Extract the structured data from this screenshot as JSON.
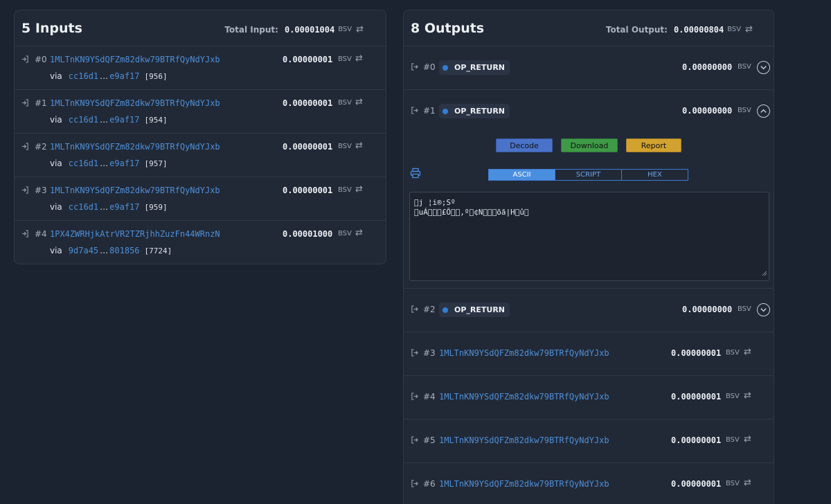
{
  "inputs": {
    "title": "5 Inputs",
    "total_label": "Total Input:",
    "total_value": "0.00001004",
    "unit": "BSV",
    "rows": [
      {
        "index": "#0",
        "address": "1MLTnKN9YSdQFZm82dkw79BTRfQyNdYJxb",
        "amount": "0.00000001",
        "unit": "BSV",
        "via_label": "via",
        "via_start": "cc16d1",
        "via_dots": "…",
        "via_end": "e9af17",
        "via_index": "[956]"
      },
      {
        "index": "#1",
        "address": "1MLTnKN9YSdQFZm82dkw79BTRfQyNdYJxb",
        "amount": "0.00000001",
        "unit": "BSV",
        "via_label": "via",
        "via_start": "cc16d1",
        "via_dots": "…",
        "via_end": "e9af17",
        "via_index": "[954]"
      },
      {
        "index": "#2",
        "address": "1MLTnKN9YSdQFZm82dkw79BTRfQyNdYJxb",
        "amount": "0.00000001",
        "unit": "BSV",
        "via_label": "via",
        "via_start": "cc16d1",
        "via_dots": "…",
        "via_end": "e9af17",
        "via_index": "[957]"
      },
      {
        "index": "#3",
        "address": "1MLTnKN9YSdQFZm82dkw79BTRfQyNdYJxb",
        "amount": "0.00000001",
        "unit": "BSV",
        "via_label": "via",
        "via_start": "cc16d1",
        "via_dots": "…",
        "via_end": "e9af17",
        "via_index": "[959]"
      },
      {
        "index": "#4",
        "address": "1PX4ZWRHjkAtrVR2TZRjhhZuzFn44WRnzN",
        "amount": "0.00001000",
        "unit": "BSV",
        "via_label": "via",
        "via_start": "9d7a45",
        "via_dots": "…",
        "via_end": "801856",
        "via_index": "[7724]"
      }
    ]
  },
  "outputs": {
    "title": "8 Outputs",
    "total_label": "Total Output:",
    "total_value": "0.00000804",
    "unit": "BSV",
    "rows": [
      {
        "index": "#0",
        "badge": "OP_RETURN",
        "amount": "0.00000000",
        "unit": "BSV"
      },
      {
        "index": "#1",
        "badge": "OP_RETURN",
        "amount": "0.00000000",
        "unit": "BSV"
      },
      {
        "index": "#2",
        "badge": "OP_RETURN",
        "amount": "0.00000000",
        "unit": "BSV"
      },
      {
        "index": "#3",
        "address": "1MLTnKN9YSdQFZm82dkw79BTRfQyNdYJxb",
        "amount": "0.00000001",
        "unit": "BSV"
      },
      {
        "index": "#4",
        "address": "1MLTnKN9YSdQFZm82dkw79BTRfQyNdYJxb",
        "amount": "0.00000001",
        "unit": "BSV"
      },
      {
        "index": "#5",
        "address": "1MLTnKN9YSdQFZm82dkw79BTRfQyNdYJxb",
        "amount": "0.00000001",
        "unit": "BSV"
      },
      {
        "index": "#6",
        "address": "1MLTnKN9YSdQFZm82dkw79BTRfQyNdYJxb",
        "amount": "0.00000001",
        "unit": "BSV"
      }
    ],
    "expanded": {
      "decode_label": "Decode",
      "download_label": "Download",
      "report_label": "Report",
      "tabs": [
        "ASCII",
        "SCRIPT",
        "HEX"
      ],
      "active_tab": "ASCII",
      "ascii_line1": "\u0000j ¦i®;Sº",
      "ascii_line2": "\u0000uÁ\u0000\u0000\u0000£Ô\u0000\u0000,º\u0000¢N\u0000\u0000\u0000õã|H\u0000û\u0000"
    }
  },
  "icons": {
    "input_icon": "sign-in-icon",
    "output_icon": "sign-out-icon",
    "swap": "⇄"
  },
  "colors": {
    "background": "#1b2230",
    "panel": "#212937",
    "link": "#4f8fd6",
    "op_dot": "#2f7fd9",
    "decode": "#4a72c8",
    "download": "#3f9a48",
    "report": "#d2a230"
  }
}
